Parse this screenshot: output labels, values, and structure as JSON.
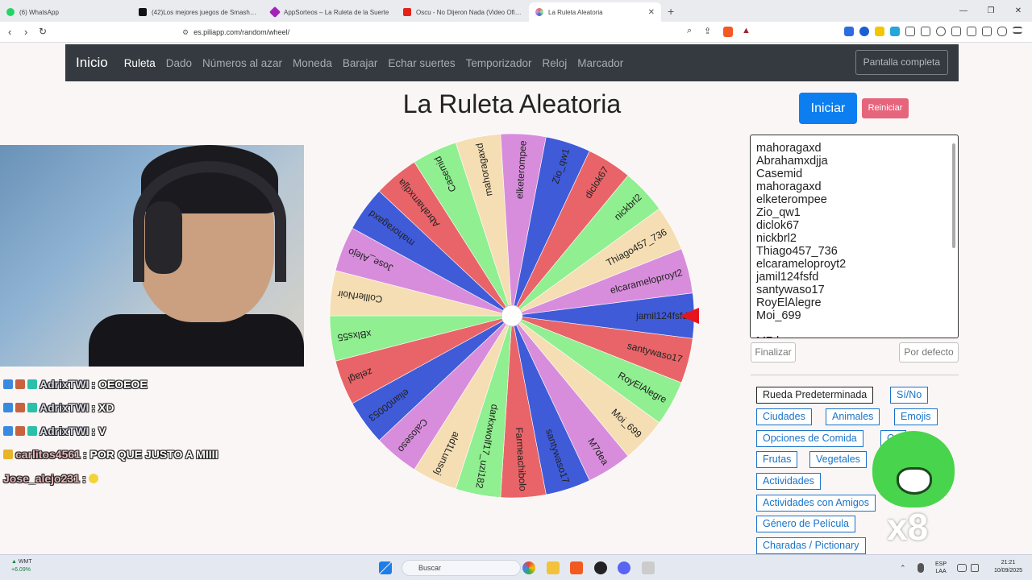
{
  "browser": {
    "tabs": [
      {
        "title": "(6) WhatsApp",
        "color": "#25d366"
      },
      {
        "title": "(42)Los mejores juegos de Smash Bros",
        "color": "#111111"
      },
      {
        "title": "AppSorteos – La Ruleta de la Suerte",
        "color": "#a321b8"
      },
      {
        "title": "Oscu - No Dijeron Nada (Video Oficial)",
        "color": "#e62117"
      },
      {
        "title": "La Ruleta Aleatoria",
        "color": "#5a6b8c"
      }
    ],
    "active_tab": 4,
    "url": "es.piliapp.com/random/wheel/"
  },
  "site": {
    "brand": "Inicio",
    "nav": [
      "Ruleta",
      "Dado",
      "Números al azar",
      "Moneda",
      "Barajar",
      "Echar suertes",
      "Temporizador",
      "Reloj",
      "Marcador"
    ],
    "active_nav": "Ruleta",
    "fullscreen": "Pantalla completa",
    "title": "La Ruleta Aleatoria",
    "start": "Iniciar",
    "reset": "Reiniciar"
  },
  "names": [
    "mahoragaxd",
    "Abrahamxdjja",
    "Casemid",
    "mahoragaxd",
    "elketerompee",
    "Zio_qw1",
    "diclok67",
    "nickbrl2",
    "Thiago457_736",
    "elcarameloproyt2",
    "jamil124fsfd",
    "santywaso17",
    "RoyElAlegre",
    "Moi_699",
    "",
    "M7dea"
  ],
  "wheel": {
    "pointer_color": "#e8141d",
    "segments": [
      {
        "label": "jamil124fsfd",
        "color": "#3f5bd8"
      },
      {
        "label": "santywaso17",
        "color": "#e96468"
      },
      {
        "label": "RoyElAlegre",
        "color": "#90ef90"
      },
      {
        "label": "Moi_699",
        "color": "#f5deb3"
      },
      {
        "label": "M7dea",
        "color": "#d88ddc"
      },
      {
        "label": "santywaso17",
        "color": "#3f5bd8"
      },
      {
        "label": "Farmeachibolo",
        "color": "#e96468"
      },
      {
        "label": "darkxwolf17_uzi182",
        "color": "#90ef90"
      },
      {
        "label": "ald1Lunsoj",
        "color": "#f5deb3"
      },
      {
        "label": "Caloseso",
        "color": "#d88ddc"
      },
      {
        "label": "elian00053",
        "color": "#3f5bd8"
      },
      {
        "label": "zelagl",
        "color": "#e96468"
      },
      {
        "label": "xBlxs55",
        "color": "#90ef90"
      },
      {
        "label": "ColllerNoir",
        "color": "#f5deb3"
      },
      {
        "label": "Jose_Alejo",
        "color": "#d88ddc"
      },
      {
        "label": "mahoragaxd",
        "color": "#3f5bd8"
      },
      {
        "label": "Abrahamxdjja",
        "color": "#e96468"
      },
      {
        "label": "Casemid",
        "color": "#90ef90"
      },
      {
        "label": "mahoragaxd",
        "color": "#f5deb3"
      },
      {
        "label": "elketerompee",
        "color": "#d88ddc"
      },
      {
        "label": "Zio_qw1",
        "color": "#3f5bd8"
      },
      {
        "label": "diclok67",
        "color": "#e96468"
      },
      {
        "label": "nickbrl2",
        "color": "#90ef90"
      },
      {
        "label": "Thiago457_736",
        "color": "#f5deb3"
      },
      {
        "label": "elcarameloproyt2",
        "color": "#d88ddc"
      }
    ]
  },
  "buttons": {
    "finish": "Finalizar",
    "default": "Por defecto"
  },
  "presets": [
    "Rueda Predeterminada",
    "Sí/No",
    "Ciudades",
    "Animales",
    "Emojis",
    "Opciones de Comida",
    "Ca",
    "Frutas",
    "Vegetales",
    "Actividades",
    "Actividades con Amigos",
    "Género de Película",
    "Charadas / Pictionary"
  ],
  "chat": [
    {
      "user": "AdrixTWI",
      "msg": " : OEOEOE"
    },
    {
      "user": "AdrixTWI",
      "msg": " : XD"
    },
    {
      "user": "AdrixTWI",
      "msg": " : V"
    },
    {
      "user": "carlitos4561",
      "msg": " : POR QUE JUSTO A MIIII"
    },
    {
      "user": "Jose_alejo231",
      "msg": " :"
    }
  ],
  "emote": {
    "multiplier": "x8"
  },
  "taskbar": {
    "ticker_name": "WMT",
    "ticker_change": "+6.09%",
    "search": "Buscar",
    "lang1": "ESP",
    "lang2": "LAA",
    "time": "21:21",
    "date": "10/09/2025"
  }
}
